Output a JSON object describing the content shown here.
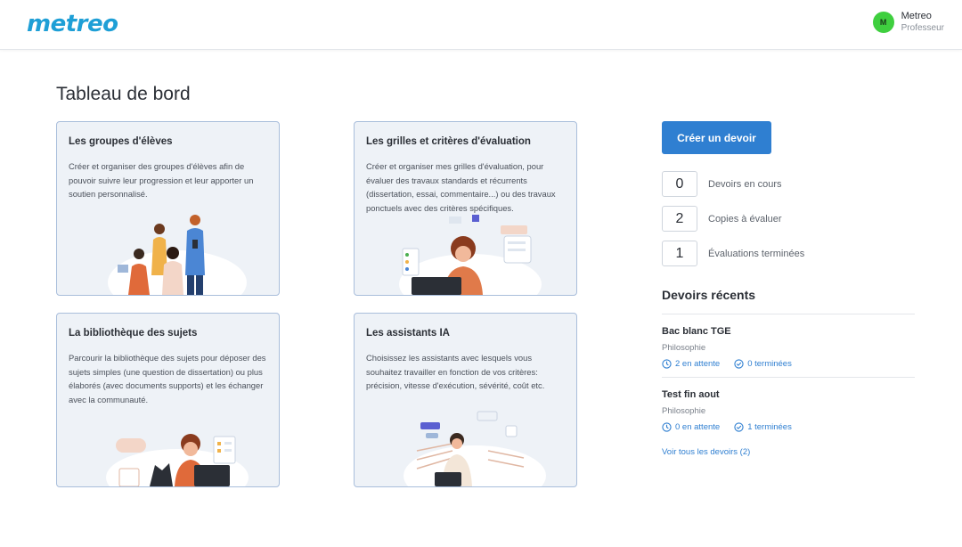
{
  "header": {
    "logo": "metreo",
    "user": {
      "initial": "M",
      "name": "Metreo",
      "role": "Professeur"
    }
  },
  "page_title": "Tableau de bord",
  "cards": [
    {
      "title": "Les groupes d'élèves",
      "description": "Créer et organiser des groupes d'élèves afin de pouvoir suivre leur progression et leur apporter un soutien personnalisé."
    },
    {
      "title": "Les grilles et critères d'évaluation",
      "description": "Créer et organiser mes grilles d'évaluation, pour évaluer des travaux standards et récurrents (dissertation, essai, commentaire...) ou des travaux ponctuels avec des critères spécifiques."
    },
    {
      "title": "La bibliothèque des sujets",
      "description": "Parcourir la bibliothèque des sujets pour déposer des sujets simples (une question de dissertation) ou plus élaborés (avec documents supports) et les échanger avec la communauté."
    },
    {
      "title": "Les assistants IA",
      "description": "Choisissez les assistants avec lesquels vous souhaitez travailler en fonction de vos critères: précision, vitesse d'exécution, sévérité, coût etc."
    }
  ],
  "create_button": "Créer un devoir",
  "stats": [
    {
      "value": "0",
      "label": "Devoirs en cours"
    },
    {
      "value": "2",
      "label": "Copies à évaluer"
    },
    {
      "value": "1",
      "label": "Évaluations terminées"
    }
  ],
  "recent": {
    "title": "Devoirs récents",
    "items": [
      {
        "title": "Bac blanc TGE",
        "subject": "Philosophie",
        "pending": "2 en attente",
        "done": "0 terminées"
      },
      {
        "title": "Test fin aout",
        "subject": "Philosophie",
        "pending": "0 en attente",
        "done": "1 terminées"
      }
    ],
    "see_all": "Voir tous les devoirs (2)"
  },
  "colors": {
    "accent": "#2f7fd1",
    "logo": "#1e9fd6",
    "card_bg": "#eef2f7",
    "card_border": "#a9bedb",
    "avatar": "#3fcf3f"
  },
  "icons": [
    "clock-icon",
    "check-circle-icon"
  ]
}
